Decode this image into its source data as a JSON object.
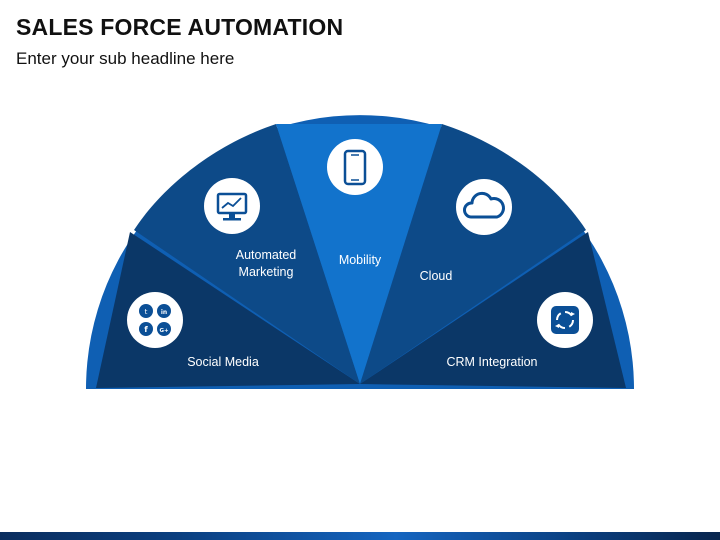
{
  "title": "SALES FORCE AUTOMATION",
  "subtitle": "Enter your sub headline here",
  "segments": [
    {
      "label": "Social Media",
      "icon": "social-media-icon"
    },
    {
      "label_line1": "Automated",
      "label_line2": "Marketing",
      "icon": "monitor-chart-icon"
    },
    {
      "label": "Mobility",
      "icon": "smartphone-icon"
    },
    {
      "label": "Cloud",
      "icon": "cloud-icon"
    },
    {
      "label": "CRM Integration",
      "icon": "crm-cycle-icon"
    }
  ],
  "colors": {
    "ring": "#0f5fb3",
    "dark": "#0b3767",
    "mid": "#0d4a88",
    "accent": "#1273cc"
  }
}
